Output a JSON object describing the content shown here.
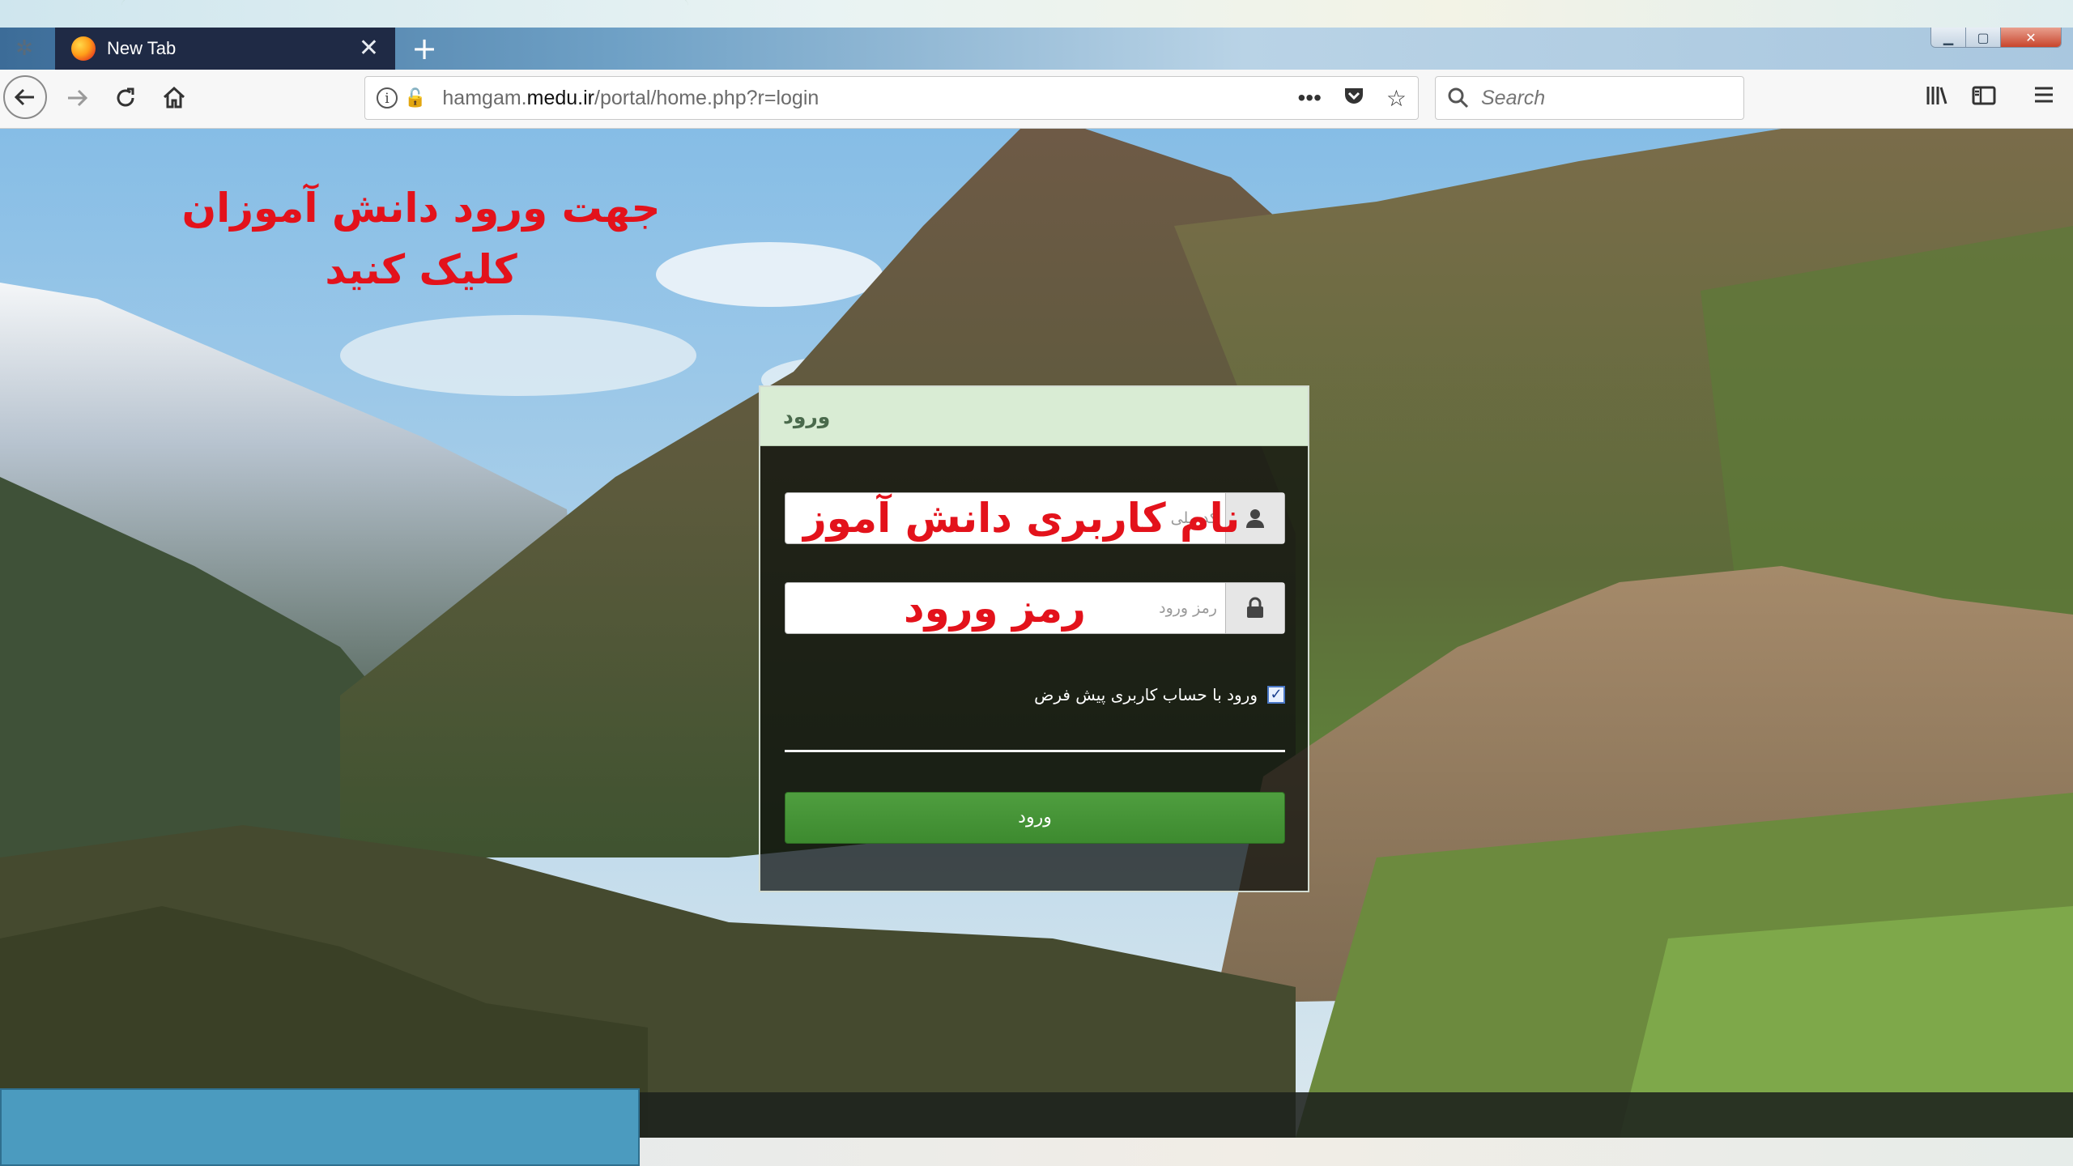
{
  "browser": {
    "tab_title": "New Tab",
    "url_prefix": "hamgam.",
    "url_domain": "medu.ir",
    "url_path": "/portal/home.php?r=login",
    "search_placeholder": "Search",
    "more_label": "•••"
  },
  "annotation": {
    "line1": "جهت ورود دانش آموزان",
    "line2": "کلیک کنید"
  },
  "login": {
    "header": "ورود",
    "username_placeholder": "کد ملی",
    "username_hint": "نام کاربری دانش آموز",
    "password_placeholder": "رمز ورود",
    "password_hint": "رمز ورود",
    "remember_label": "ورود با حساب کاربری پیش فرض",
    "remember_checked": true,
    "submit_label": "ورود"
  },
  "colors": {
    "annotation_red": "#e3121b",
    "login_header_bg": "#d9ecd4",
    "submit_green": "#3d8a2f",
    "tab_bg": "#1f2a45",
    "slide_blue": "#4b9bbf"
  },
  "icons": [
    "settings-icon",
    "firefox-icon",
    "close-icon",
    "plus-icon",
    "back-icon",
    "forward-icon",
    "reload-icon",
    "home-icon",
    "info-icon",
    "insecure-lock-icon",
    "more-icon",
    "pocket-icon",
    "star-icon",
    "search-icon",
    "library-icon",
    "sidebar-icon",
    "menu-icon",
    "user-icon",
    "lock-icon"
  ]
}
